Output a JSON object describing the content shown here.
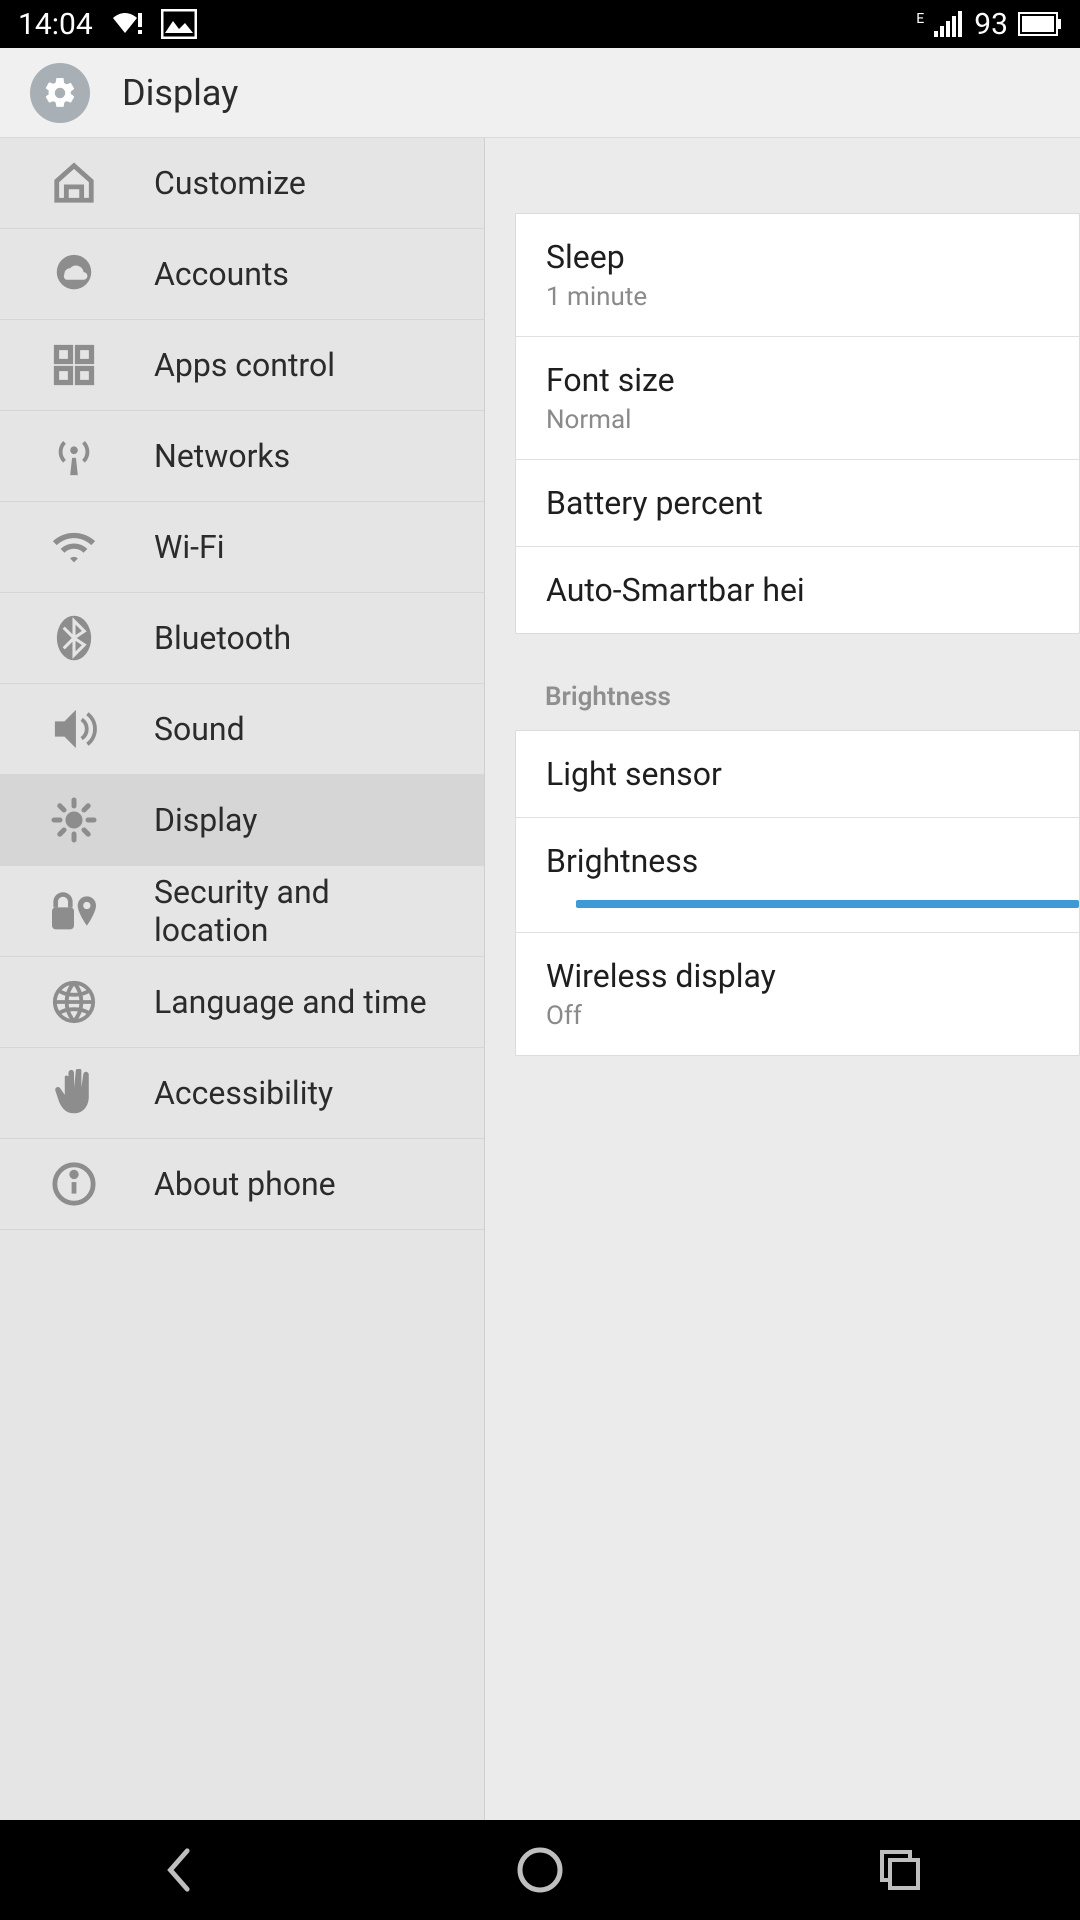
{
  "status": {
    "time": "14:04",
    "battery": "93",
    "network_badge": "E"
  },
  "header": {
    "title": "Display"
  },
  "sidebar": {
    "items": [
      {
        "label": "Customize",
        "icon": "home"
      },
      {
        "label": "Accounts",
        "icon": "cloud-bubble"
      },
      {
        "label": "Apps control",
        "icon": "grid"
      },
      {
        "label": "Networks",
        "icon": "antenna"
      },
      {
        "label": "Wi-Fi",
        "icon": "wifi"
      },
      {
        "label": "Bluetooth",
        "icon": "bluetooth"
      },
      {
        "label": "Sound",
        "icon": "speaker"
      },
      {
        "label": "Display",
        "icon": "brightness",
        "selected": true
      },
      {
        "label": "Security and location",
        "icon": "lock-pin"
      },
      {
        "label": "Language and time",
        "icon": "globe"
      },
      {
        "label": "Accessibility",
        "icon": "hand"
      },
      {
        "label": "About phone",
        "icon": "info"
      }
    ]
  },
  "detail": {
    "group1": [
      {
        "title": "Sleep",
        "sub": "1 minute"
      },
      {
        "title": "Font size",
        "sub": "Normal"
      },
      {
        "title": "Battery percent"
      },
      {
        "title": "Auto-Smartbar hei"
      }
    ],
    "section_label": "Brightness",
    "group2": [
      {
        "title": "Light sensor"
      },
      {
        "title": "Brightness",
        "slider": true
      },
      {
        "title": "Wireless display",
        "sub": "Off"
      }
    ]
  }
}
